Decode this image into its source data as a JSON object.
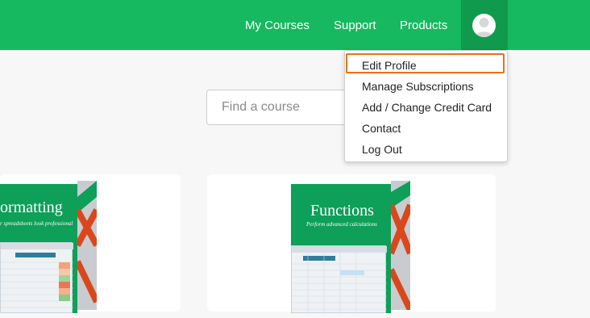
{
  "nav": {
    "my_courses": "My Courses",
    "support": "Support",
    "products": "Products"
  },
  "profile_menu": {
    "items": [
      {
        "label": "Edit Profile",
        "highlighted": true
      },
      {
        "label": "Manage Subscriptions"
      },
      {
        "label": "Add / Change Credit Card"
      },
      {
        "label": "Contact"
      },
      {
        "label": "Log Out"
      }
    ]
  },
  "search": {
    "placeholder": "Find a course"
  },
  "courses": [
    {
      "title": "ormatting",
      "subtitle": "r spreadsheets look professional"
    },
    {
      "title": "Functions",
      "subtitle": "Perform advanced calculations"
    }
  ],
  "colors": {
    "header_green": "#16b95f",
    "avatar_bg": "#0f9a4d",
    "box_green": "#0e9f58",
    "highlight_orange": "#e8701f",
    "box_side_red": "#d9481c"
  },
  "icons": {
    "avatar": "user-silhouette-icon"
  }
}
